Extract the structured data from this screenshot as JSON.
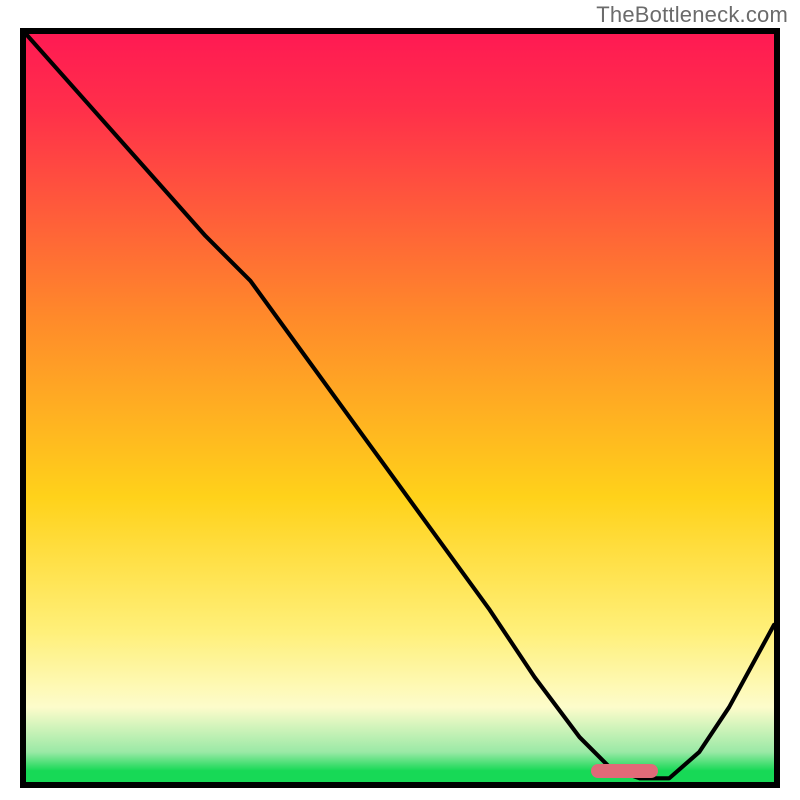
{
  "attribution": "TheBottleneck.com",
  "colors": {
    "top": "#ff1a53",
    "red": "#ff2f4a",
    "orange": "#ff8a2a",
    "yellow": "#ffd21a",
    "paleyellow": "#fff07a",
    "cream": "#fdfccb",
    "mint": "#9ae9a6",
    "green": "#17d956",
    "marker": "#e06a78",
    "curve": "#000000"
  },
  "chart_data": {
    "type": "line",
    "title": "",
    "xlabel": "",
    "ylabel": "",
    "xlim": [
      0,
      100
    ],
    "ylim": [
      0,
      100
    ],
    "x": [
      0,
      8,
      16,
      24,
      30,
      38,
      46,
      54,
      62,
      68,
      74,
      78,
      82,
      86,
      90,
      94,
      100
    ],
    "y": [
      100,
      91,
      82,
      73,
      67,
      56,
      45,
      34,
      23,
      14,
      6,
      2,
      0.5,
      0.5,
      4,
      10,
      21
    ],
    "marker": {
      "x_center": 80,
      "width": 9,
      "y": 0.5
    },
    "note": "x,y are percentages of the plot box; y=0 at bottom, y=100 at top. Values estimated from pixels."
  }
}
